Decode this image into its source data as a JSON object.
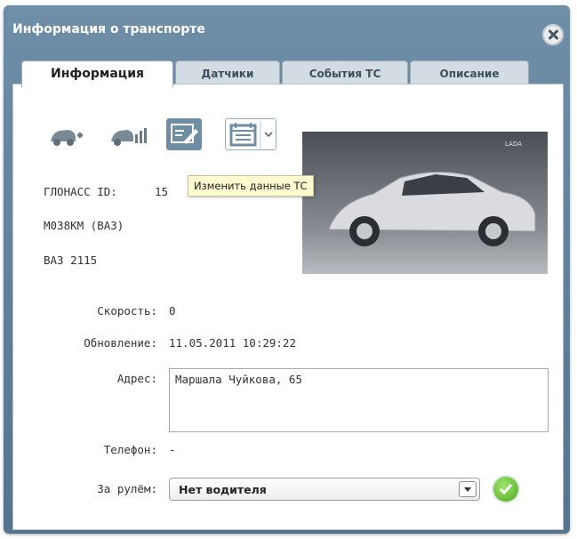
{
  "window": {
    "title": "Информация о транспорте"
  },
  "tabs": [
    {
      "label": "Информация",
      "active": true
    },
    {
      "label": "Датчики",
      "active": false
    },
    {
      "label": "События ТС",
      "active": false
    },
    {
      "label": "Описание",
      "active": false
    }
  ],
  "toolbar": {
    "icons": [
      "car-add-icon",
      "car-stats-icon",
      "edit-vehicle-icon",
      "calendar-icon",
      "chevron-down-icon"
    ],
    "tooltip": "Изменить данные ТС"
  },
  "vehicle": {
    "glonass_label": "ГЛОНАСС ID:",
    "glonass_value": "15",
    "plate": "М038КМ (ВАЗ)",
    "model": "ВАЗ 2115",
    "photo_caption": "LADA"
  },
  "fields": {
    "speed_label": "Скорость:",
    "speed_value": "0",
    "updated_label": "Обновление:",
    "updated_value": "11.05.2011 10:29:22",
    "address_label": "Адрес:",
    "address_value": "Маршала Чуйкова, 65",
    "phone_label": "Телефон:",
    "phone_value": "-",
    "driver_label": "За рулём:",
    "driver_value": "Нет водителя"
  },
  "colors": {
    "title_bar": "#5f7e98",
    "ok_green": "#5cb82b"
  }
}
